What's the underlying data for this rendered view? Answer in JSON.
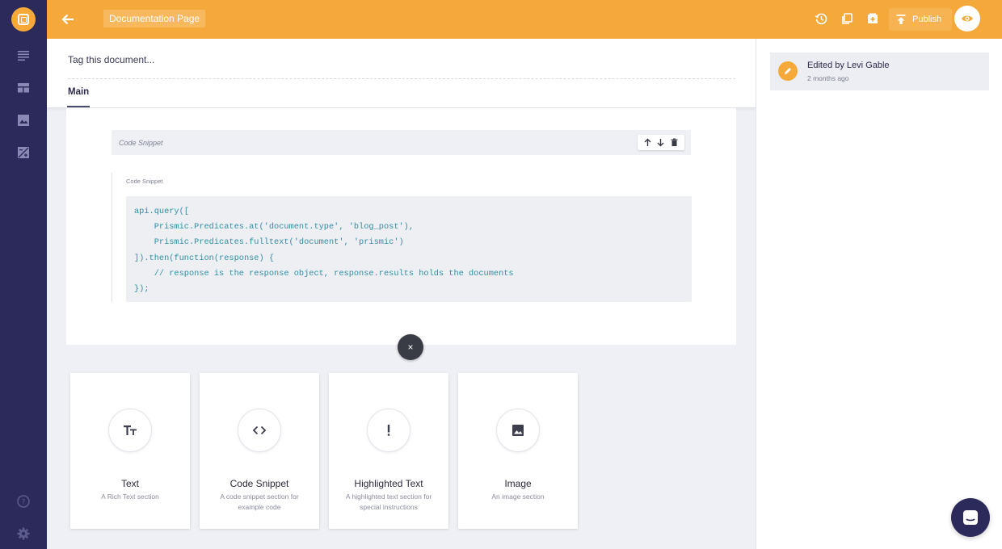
{
  "topbar": {
    "document_title": "Documentation Page",
    "publish_label": "Publish",
    "accent_color": "#f6a93b"
  },
  "sidebar": {
    "background_color": "#2b2a5b",
    "items": [
      {
        "icon": "list-icon"
      },
      {
        "icon": "layout-icon"
      },
      {
        "icon": "image-icon"
      },
      {
        "icon": "exposure-icon"
      }
    ],
    "footer_items": [
      {
        "icon": "help-icon"
      },
      {
        "icon": "gear-icon"
      }
    ]
  },
  "document": {
    "tag_placeholder": "Tag this document...",
    "tabs": [
      {
        "label": "Main",
        "active": true
      }
    ]
  },
  "slice": {
    "header_label": "Code Snippet",
    "field_label": "Code Snippet",
    "code_lines": [
      "api.query([",
      "    Prismic.Predicates.at('document.type', 'blog_post'),",
      "    Prismic.Predicates.fulltext('document', 'prismic')",
      "]).then(function(response) {",
      "    // response is the response object, response.results holds the documents",
      "});"
    ]
  },
  "close_label": "×",
  "slice_choices": [
    {
      "title": "Text",
      "description": "A Rich Text section",
      "icon": "text-format-icon"
    },
    {
      "title": "Code Snippet",
      "description": "A code snippet section for example code",
      "icon": "code-icon"
    },
    {
      "title": "Highlighted Text",
      "description": "A highlighted text section for special instructions",
      "icon": "exclamation-icon"
    },
    {
      "title": "Image",
      "description": "An image section",
      "icon": "image-icon"
    }
  ],
  "history": {
    "title": "Edited by Levi Gable",
    "time": "2 months ago"
  }
}
